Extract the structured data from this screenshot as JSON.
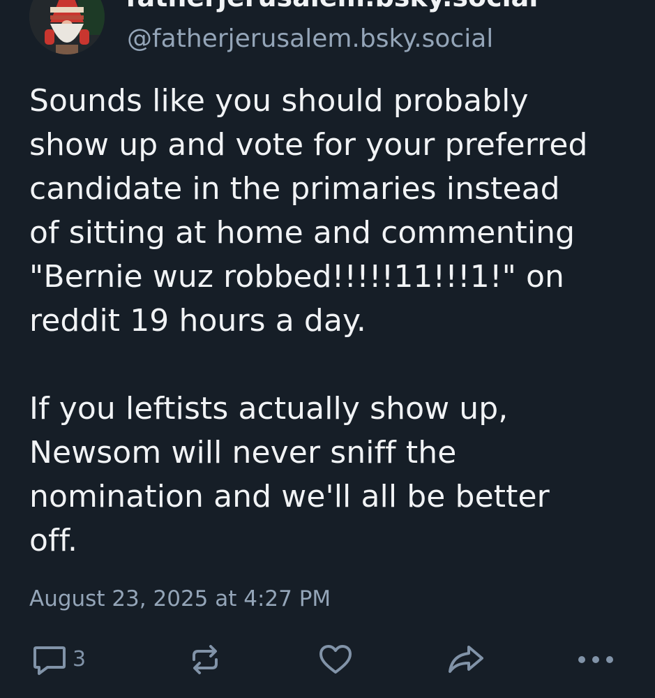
{
  "author": {
    "display_name": "fatherjerusalem.bsky.social",
    "handle": "@fatherjerusalem.bsky.social",
    "avatar_icon": "gnome-avatar"
  },
  "post": {
    "text": "Sounds like you should probably\nshow up and vote for your preferred\ncandidate in the primaries instead\nof sitting at home and commenting\n\"Bernie wuz robbed!!!!!11!!!1!\" on\nreddit 19 hours a day.\n\nIf you leftists actually show up,\nNewsom will never sniff the\nnomination and we'll all be better\noff.",
    "timestamp": "August 23, 2025 at 4:27 PM"
  },
  "actions": {
    "reply": {
      "icon": "reply-icon",
      "count": "3"
    },
    "repost": {
      "icon": "repost-icon"
    },
    "like": {
      "icon": "heart-icon"
    },
    "share": {
      "icon": "share-icon"
    },
    "more": {
      "icon": "more-icon"
    }
  },
  "colors": {
    "background": "#161e27",
    "text": "#f1f3f5",
    "muted": "#94a5b8",
    "icon": "#8193a8"
  }
}
